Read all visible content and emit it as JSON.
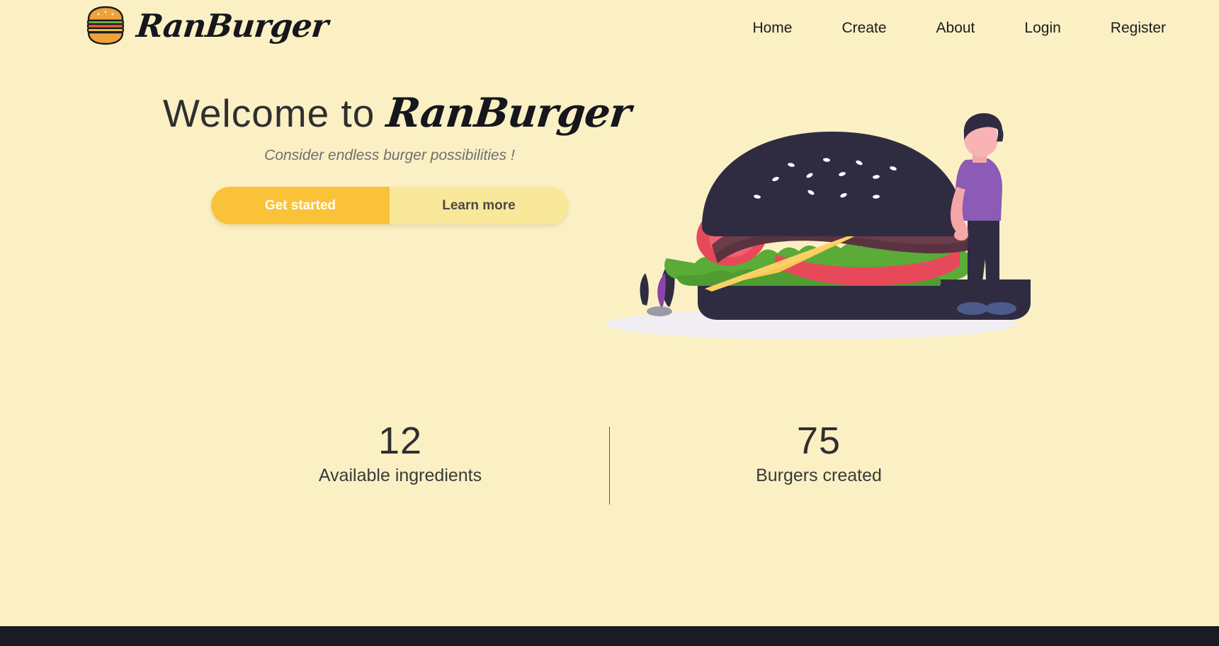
{
  "theme": {
    "background": "#fbf0c4",
    "primary_button": "#fac239",
    "secondary_button": "#fae89a",
    "text_dark": "#2f2f2f",
    "text_muted": "#6f6f6f",
    "bottom_bar": "#1b1b23"
  },
  "header": {
    "logo_icon": "burger-icon",
    "brand_name": "RanBurger",
    "nav": [
      {
        "label": "Home"
      },
      {
        "label": "Create"
      },
      {
        "label": "About"
      },
      {
        "label": "Login"
      },
      {
        "label": "Register"
      }
    ]
  },
  "hero": {
    "headline_prefix": "Welcome to ",
    "headline_brand": "RanBurger",
    "subtitle": "Consider endless burger possibilities !",
    "primary_button": "Get started",
    "secondary_button": "Learn more",
    "illustration": "burger-with-person-illustration"
  },
  "stats": [
    {
      "value": "12",
      "label": "Available ingredients"
    },
    {
      "value": "75",
      "label": "Burgers created"
    }
  ]
}
